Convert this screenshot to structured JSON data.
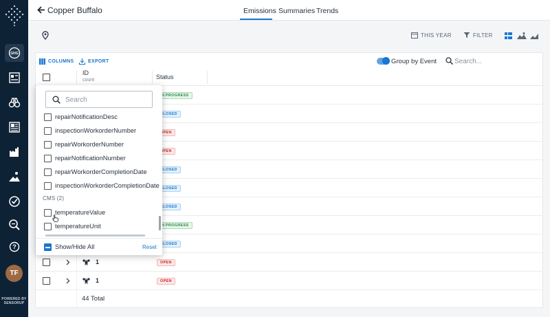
{
  "header": {
    "title": "Copper Buffalo",
    "tabs": [
      {
        "label": "Emissions",
        "active": true
      },
      {
        "label": "Summaries",
        "active": false
      },
      {
        "label": "Trends",
        "active": false
      }
    ]
  },
  "subbar": {
    "date_filter": "THIS YEAR",
    "filter_label": "FILTER"
  },
  "toolbar": {
    "columns_label": "COLUMNS",
    "export_label": "EXPORT",
    "group_by_event_label": "Group by Event",
    "group_by_event_on": true,
    "search_placeholder": "Search..."
  },
  "table": {
    "headers": {
      "id": "ID",
      "id_sub": "count",
      "status": "Status"
    },
    "rows": [
      {
        "id": "",
        "status": "IN PROGRESS",
        "kind": "inprog"
      },
      {
        "id": "",
        "status": "CLOSED",
        "kind": "closed"
      },
      {
        "id": "",
        "status": "OPEN",
        "kind": "open"
      },
      {
        "id": "",
        "status": "OPEN",
        "kind": "open"
      },
      {
        "id": "",
        "status": "CLOSED",
        "kind": "closed"
      },
      {
        "id": "",
        "status": "CLOSED",
        "kind": "closed"
      },
      {
        "id": "",
        "status": "CLOSED",
        "kind": "closed"
      },
      {
        "id": "",
        "status": "IN PROGRESS",
        "kind": "inprog"
      },
      {
        "id": "",
        "status": "CLOSED",
        "kind": "closed"
      },
      {
        "id": "1",
        "status": "OPEN",
        "kind": "open"
      },
      {
        "id": "1",
        "status": "OPEN",
        "kind": "open"
      }
    ],
    "total": "44 Total"
  },
  "columns_dropdown": {
    "search_placeholder": "Search",
    "items": [
      "repairNotificationDesc",
      "inspectionWorkorderNumber",
      "repairWorkorderNumber",
      "repairNotificationNumber",
      "repairWorkorderCompletionDate",
      "inspectionWorkorderCompletionDate"
    ],
    "group_label": "CMS (2)",
    "group_items": [
      "temperatureValue",
      "temperatureUnit"
    ],
    "show_hide_label": "Show/Hide All",
    "reset_label": "Reset"
  },
  "sidebar": {
    "avatar_initials": "TF",
    "powered_line1": "POWERED BY",
    "powered_line2": "SENSORUP"
  },
  "colors": {
    "sidebar_bg": "#0e2236",
    "accent": "#1976d2",
    "open": "#c62828",
    "closed": "#1976d2",
    "in_progress": "#2e8b45"
  }
}
